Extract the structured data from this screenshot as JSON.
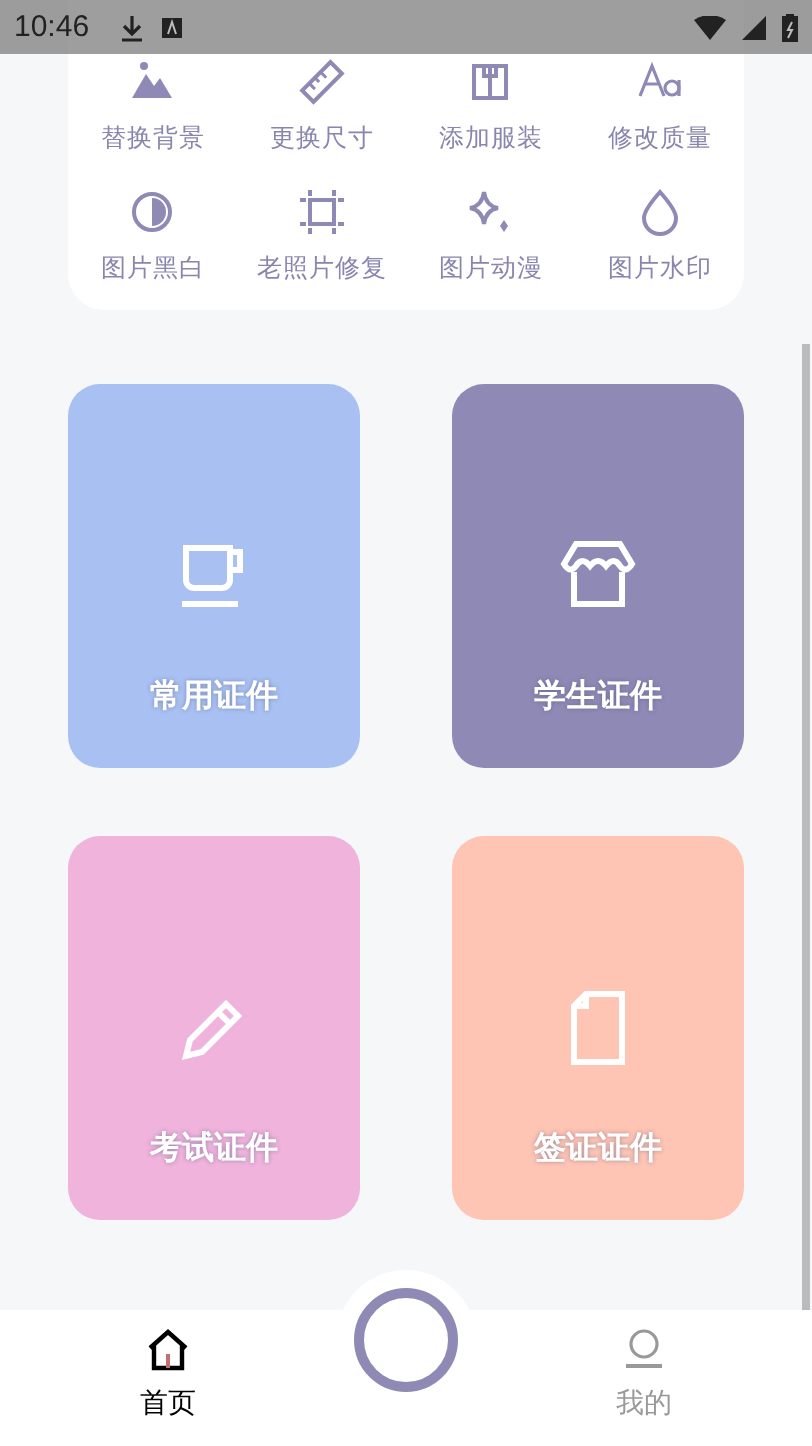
{
  "status_bar": {
    "time": "10:46"
  },
  "tools": [
    {
      "label": "替换背景",
      "kind": "mountain"
    },
    {
      "label": "更换尺寸",
      "kind": "ruler"
    },
    {
      "label": "添加服装",
      "kind": "shirt"
    },
    {
      "label": "修改质量",
      "kind": "font"
    },
    {
      "label": "图片黑白",
      "kind": "contrast"
    },
    {
      "label": "老照片修复",
      "kind": "crop"
    },
    {
      "label": "图片动漫",
      "kind": "sparkle"
    },
    {
      "label": "图片水印",
      "kind": "drop"
    }
  ],
  "cards": [
    {
      "label": "常用证件",
      "kind": "cup",
      "color": "#a9c0f2"
    },
    {
      "label": "学生证件",
      "kind": "shop",
      "color": "#8f89b6"
    },
    {
      "label": "考试证件",
      "kind": "pencil",
      "color": "#efb3dc"
    },
    {
      "label": "签证证件",
      "kind": "file",
      "color": "#fec4b4"
    }
  ],
  "tabs": [
    {
      "label": "首页",
      "selected": true
    },
    {
      "label": "我的",
      "selected": false
    }
  ]
}
